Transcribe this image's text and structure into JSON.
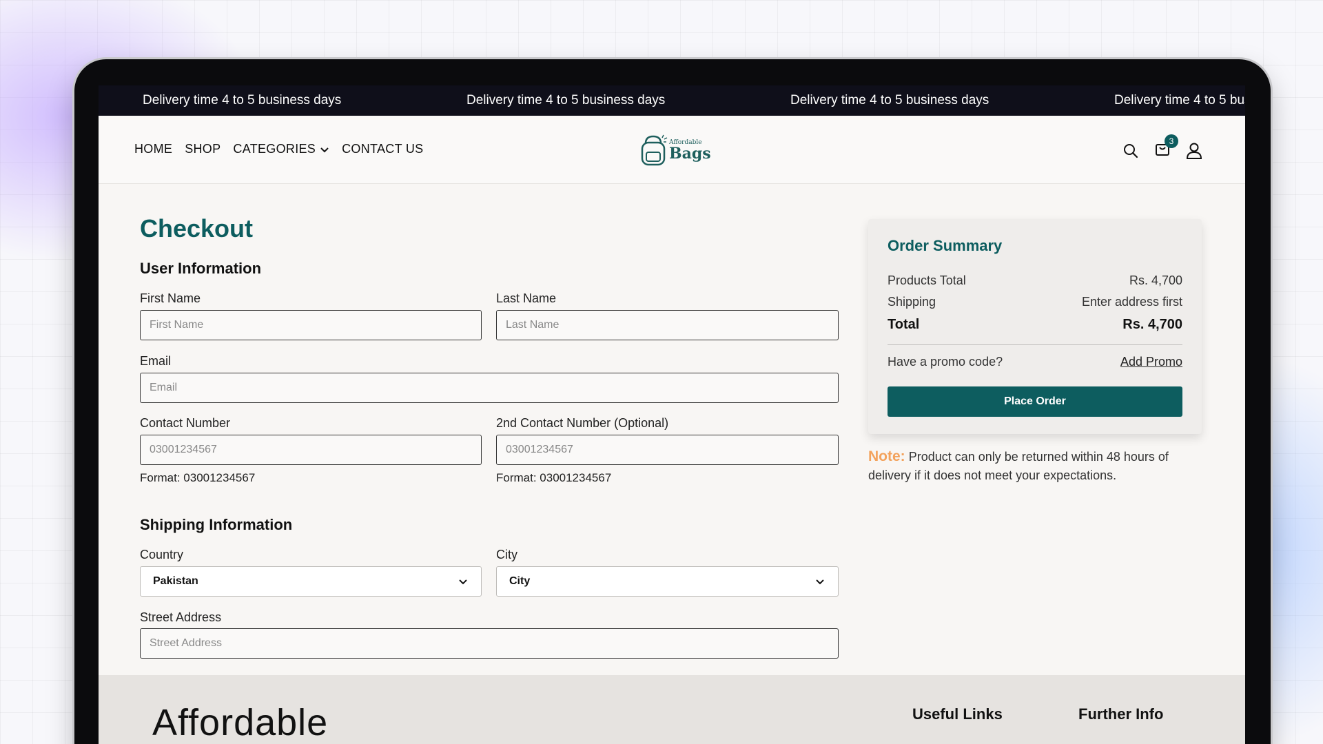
{
  "ticker": {
    "message": "Delivery time 4 to 5 business days"
  },
  "nav": {
    "home": "HOME",
    "shop": "SHOP",
    "categories": "CATEGORIES",
    "contact": "CONTACT US",
    "logo_small": "Affordable",
    "logo_big": "Bags",
    "cart_count": "3"
  },
  "checkout": {
    "title": "Checkout",
    "user_section": "User Information",
    "first_name_label": "First Name",
    "first_name_placeholder": "First Name",
    "last_name_label": "Last Name",
    "last_name_placeholder": "Last Name",
    "email_label": "Email",
    "email_placeholder": "Email",
    "contact_label": "Contact Number",
    "contact_placeholder": "03001234567",
    "contact2_label": "2nd Contact Number (Optional)",
    "contact2_placeholder": "03001234567",
    "format_hint": "Format: 03001234567",
    "shipping_section": "Shipping Information",
    "country_label": "Country",
    "country_value": "Pakistan",
    "city_label": "City",
    "city_value": "City",
    "street_label": "Street Address",
    "street_placeholder": "Street Address"
  },
  "summary": {
    "title": "Order Summary",
    "products_total_label": "Products Total",
    "products_total_value": "Rs. 4,700",
    "shipping_label": "Shipping",
    "shipping_value": "Enter address first",
    "total_label": "Total",
    "total_value": "Rs. 4,700",
    "promo_question": "Have a promo code?",
    "promo_link": "Add Promo",
    "place_order": "Place Order"
  },
  "note": {
    "label": "Note:",
    "text": "Product can only be returned within 48 hours of delivery if it does not meet your expectations."
  },
  "footer": {
    "brand": "Affordable",
    "useful_links": "Useful Links",
    "further_info": "Further Info"
  },
  "colors": {
    "accent": "#0d5d5f",
    "note_orange": "#f3a25c",
    "ticker_bg": "#0f0f1a"
  }
}
